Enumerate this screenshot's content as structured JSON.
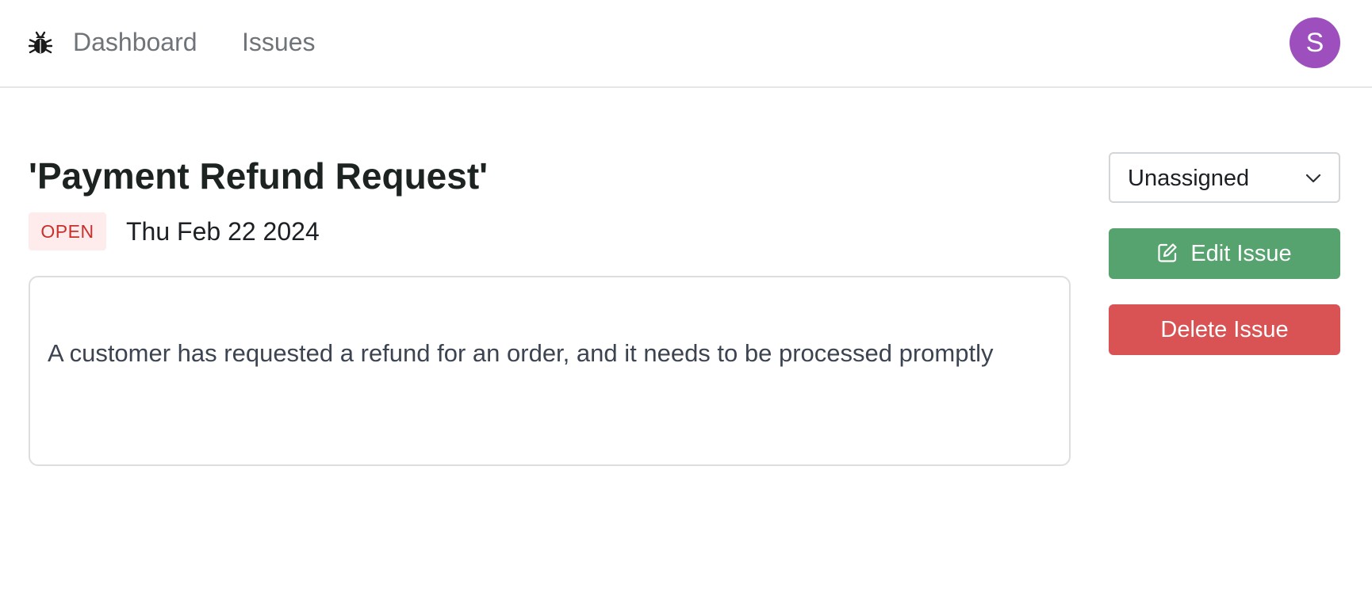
{
  "nav": {
    "logo_icon": "bug-icon",
    "links": [
      {
        "label": "Dashboard"
      },
      {
        "label": "Issues"
      }
    ],
    "avatar_initial": "S",
    "avatar_color": "#9c4fbd"
  },
  "issue": {
    "title": "'Payment Refund Request'",
    "status": "OPEN",
    "date": "Thu Feb 22 2024",
    "description": "A customer has requested a refund for an order, and it needs to be processed promptly"
  },
  "actions": {
    "assignee": {
      "selected": "Unassigned",
      "icon": "chevron-down-icon"
    },
    "edit_label": "Edit Issue",
    "edit_icon": "edit-icon",
    "delete_label": "Delete Issue"
  },
  "colors": {
    "status_bg": "#feecec",
    "status_text": "#c9302c",
    "edit_button": "#56a36f",
    "delete_button": "#d95254"
  }
}
